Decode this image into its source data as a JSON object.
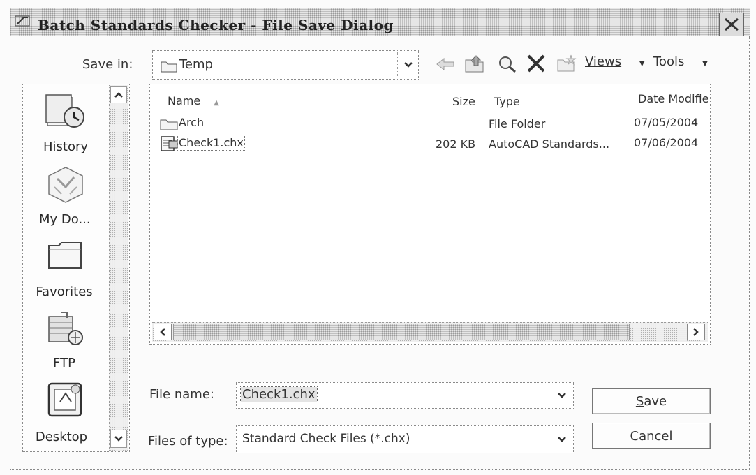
{
  "window": {
    "title": "Batch Standards Checker - File Save Dialog"
  },
  "toolbar": {
    "save_in_label": "Save in:",
    "save_in_value": "Temp",
    "views_label": "Views",
    "tools_label": "Tools"
  },
  "places": [
    {
      "label": "History",
      "icon": "history-icon"
    },
    {
      "label": "My Do...",
      "icon": "my-documents-icon"
    },
    {
      "label": "Favorites",
      "icon": "favorites-folder-icon"
    },
    {
      "label": "FTP",
      "icon": "ftp-icon"
    },
    {
      "label": "Desktop",
      "icon": "desktop-icon"
    }
  ],
  "file_list": {
    "columns": [
      "Name",
      "Size",
      "Type",
      "Date Modifie"
    ],
    "rows": [
      {
        "name": "Arch",
        "size": "",
        "type": "File Folder",
        "date": "07/05/2004",
        "icon": "folder-icon"
      },
      {
        "name": "Check1.chx",
        "size": "202 KB",
        "type": "AutoCAD Standards...",
        "date": "07/06/2004",
        "icon": "chx-file-icon"
      }
    ]
  },
  "form": {
    "file_name_label": "File name:",
    "file_name_value": "Check1.chx",
    "file_type_label": "Files of type:",
    "file_type_value": "Standard Check Files (*.chx)"
  },
  "buttons": {
    "save_mnemonic": "S",
    "save_rest": "ave",
    "cancel": "Cancel"
  },
  "colors": {
    "title_bar": "#d6d6d6",
    "window_bg": "#fbfbfb"
  }
}
